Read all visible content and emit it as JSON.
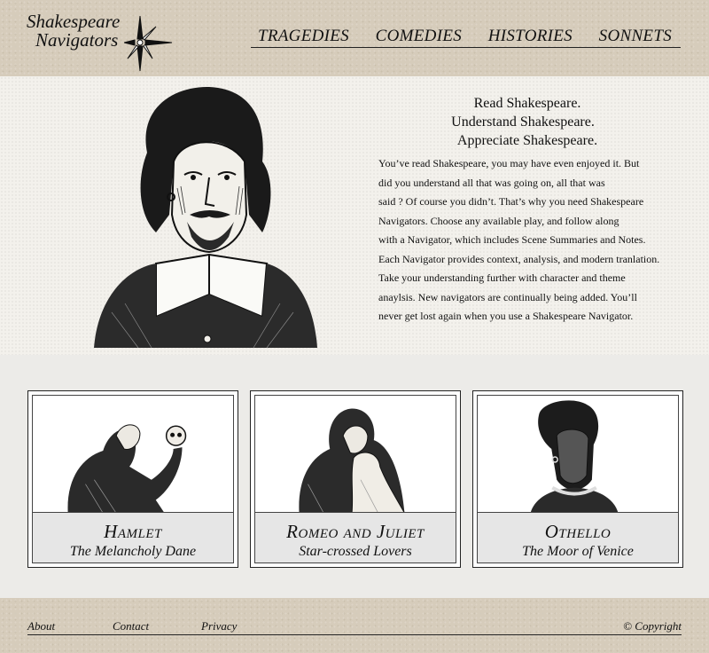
{
  "brand": {
    "line1": "Shakespeare",
    "line2": "Navigators"
  },
  "nav": [
    "TRAGEDIES",
    "COMEDIES",
    "HISTORIES",
    "SONNETS"
  ],
  "hero": {
    "tagline": [
      "Read Shakespeare.",
      "Understand Shakespeare.",
      "Appreciate Shakespeare."
    ],
    "intro_lines": [
      "You’ve read Shakespeare, you may have even enjoyed it. But",
      "did you understand all that was going on, all that was",
      "said ? Of course you didn’t. That’s why you need Shakespeare",
      "Navigators. Choose any available play, and follow along",
      "with a Navigator, which includes Scene Summaries and Notes.",
      "Each Navigator provides context, analysis, and modern tranlation.",
      "Take your understanding further with character and theme",
      "anaylsis. New navigators are  continually being added. You’ll",
      "never get lost again when you use a Shakespeare Navigator."
    ]
  },
  "plays": [
    {
      "title": "Hamlet",
      "subtitle": "The Melancholy Dane"
    },
    {
      "title": "Romeo and Juliet",
      "subtitle": "Star-crossed Lovers"
    },
    {
      "title": "Othello",
      "subtitle": "The Moor of Venice"
    }
  ],
  "footer": {
    "about": "About",
    "contact": "Contact",
    "privacy": "Privacy",
    "copyright": "© Copyright"
  },
  "colors": {
    "header_bg": "#d6ccbb",
    "hero_bg": "#f3f1ec",
    "body_bg": "#ecebe8",
    "caption_bg": "#e6e6e6"
  }
}
